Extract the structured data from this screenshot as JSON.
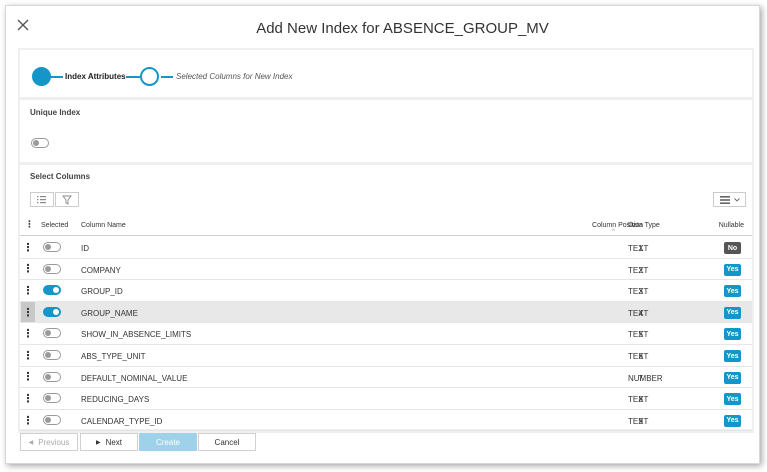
{
  "dialog": {
    "title": "Add New Index for ABSENCE_GROUP_MV"
  },
  "wizard": {
    "steps": [
      {
        "label": "Index Attributes",
        "active": true
      },
      {
        "label": "Selected Columns for New Index",
        "active": false
      }
    ]
  },
  "unique_index": {
    "title": "Unique Index",
    "enabled": false
  },
  "select_columns": {
    "title": "Select Columns",
    "headers": {
      "selected": "Selected",
      "column_name": "Column Name",
      "column_position": "Column Position",
      "data_type": "Data Type",
      "nullable": "Nullable"
    },
    "rows": [
      {
        "selected": false,
        "name": "ID",
        "position": "1",
        "type": "TEXT",
        "nullable": "No"
      },
      {
        "selected": false,
        "name": "COMPANY",
        "position": "2",
        "type": "TEXT",
        "nullable": "Yes"
      },
      {
        "selected": true,
        "name": "GROUP_ID",
        "position": "3",
        "type": "TEXT",
        "nullable": "Yes"
      },
      {
        "selected": true,
        "name": "GROUP_NAME",
        "position": "4",
        "type": "TEXT",
        "nullable": "Yes",
        "highlighted": true
      },
      {
        "selected": false,
        "name": "SHOW_IN_ABSENCE_LIMITS",
        "position": "5",
        "type": "TEXT",
        "nullable": "Yes"
      },
      {
        "selected": false,
        "name": "ABS_TYPE_UNIT",
        "position": "6",
        "type": "TEXT",
        "nullable": "Yes"
      },
      {
        "selected": false,
        "name": "DEFAULT_NOMINAL_VALUE",
        "position": "7",
        "type": "NUMBER",
        "nullable": "Yes"
      },
      {
        "selected": false,
        "name": "REDUCING_DAYS",
        "position": "8",
        "type": "TEXT",
        "nullable": "Yes"
      },
      {
        "selected": false,
        "name": "CALENDAR_TYPE_ID",
        "position": "9",
        "type": "TEXT",
        "nullable": "Yes"
      }
    ]
  },
  "footer": {
    "previous": "Previous",
    "next": "Next",
    "create": "Create",
    "cancel": "Cancel"
  },
  "colors": {
    "accent": "#1596c8",
    "no_badge": "#555555",
    "create_button": "#9fd1ea"
  },
  "icons": [
    "close-icon",
    "list-icon",
    "filter-icon",
    "columns-menu-icon",
    "chevron-down-icon",
    "kebab-icon",
    "sort-caret-icon",
    "caret-left-icon",
    "caret-right-icon"
  ]
}
